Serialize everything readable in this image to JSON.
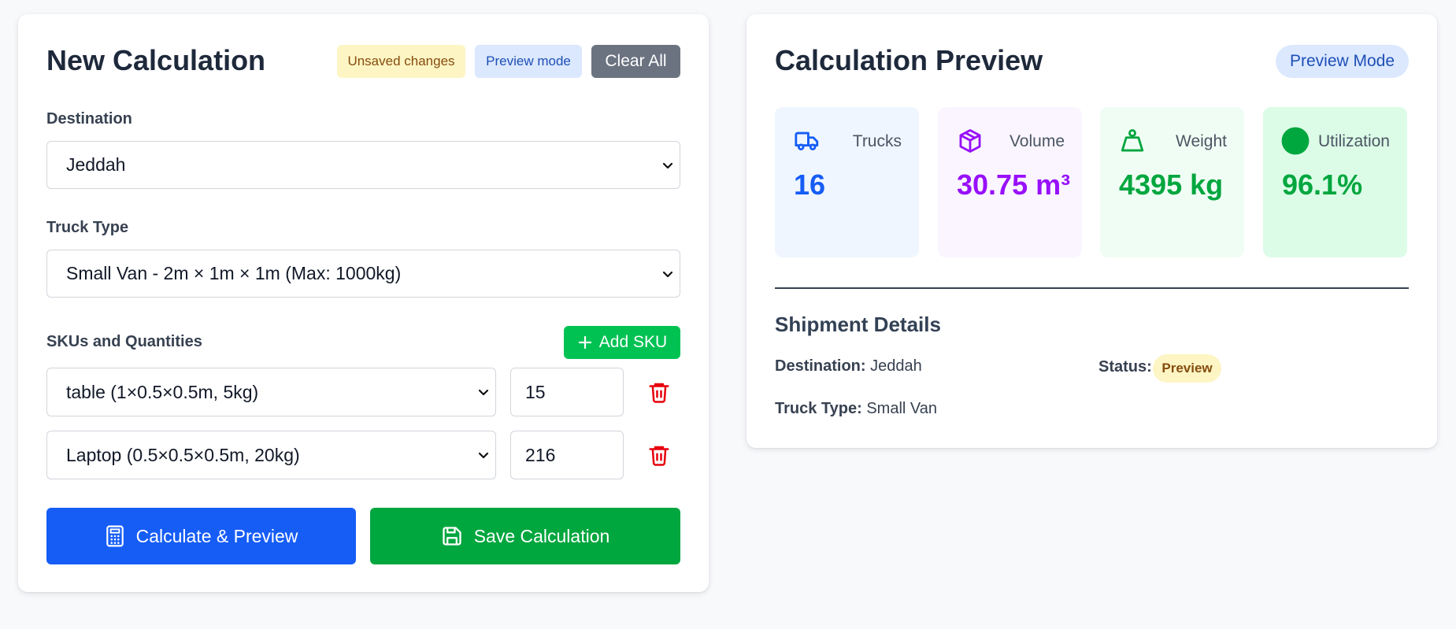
{
  "form": {
    "title": "New Calculation",
    "badge_unsaved": "Unsaved changes",
    "badge_preview": "Preview mode",
    "clear_all": "Clear All",
    "destination_label": "Destination",
    "destination_value": "Jeddah",
    "truck_type_label": "Truck Type",
    "truck_type_value": "Small Van - 2m × 1m × 1m (Max: 1000kg)",
    "skus_label": "SKUs and Quantities",
    "add_sku": "Add SKU",
    "skus": [
      {
        "sku": "table (1×0.5×0.5m, 5kg)",
        "quantity": "15"
      },
      {
        "sku": "Laptop (0.5×0.5×0.5m, 20kg)",
        "quantity": "216"
      }
    ],
    "calculate_button": "Calculate & Preview",
    "save_button": "Save Calculation"
  },
  "preview": {
    "title": "Calculation Preview",
    "mode_badge": "Preview Mode",
    "stats": [
      {
        "label": "Trucks",
        "value": "16",
        "icon": "truck-icon",
        "bg": "#eff6ff",
        "color": "#165df6"
      },
      {
        "label": "Volume",
        "value": "30.75 m³",
        "icon": "package-icon",
        "bg": "#faf5ff",
        "color": "#9810fa"
      },
      {
        "label": "Weight",
        "value": "4395 kg",
        "icon": "weight-icon",
        "bg": "#f0fdf4",
        "color": "#00a63e"
      },
      {
        "label": "Utilization",
        "value": "96.1%",
        "icon": "status-dot-icon",
        "bg": "#dcfce7",
        "color": "#00a63e"
      }
    ],
    "shipment_title": "Shipment Details",
    "destination_label": "Destination:",
    "destination_value": "Jeddah",
    "status_label": "Status:",
    "status_value": "Preview",
    "truck_type_label": "Truck Type:",
    "truck_type_value": "Small Van"
  }
}
